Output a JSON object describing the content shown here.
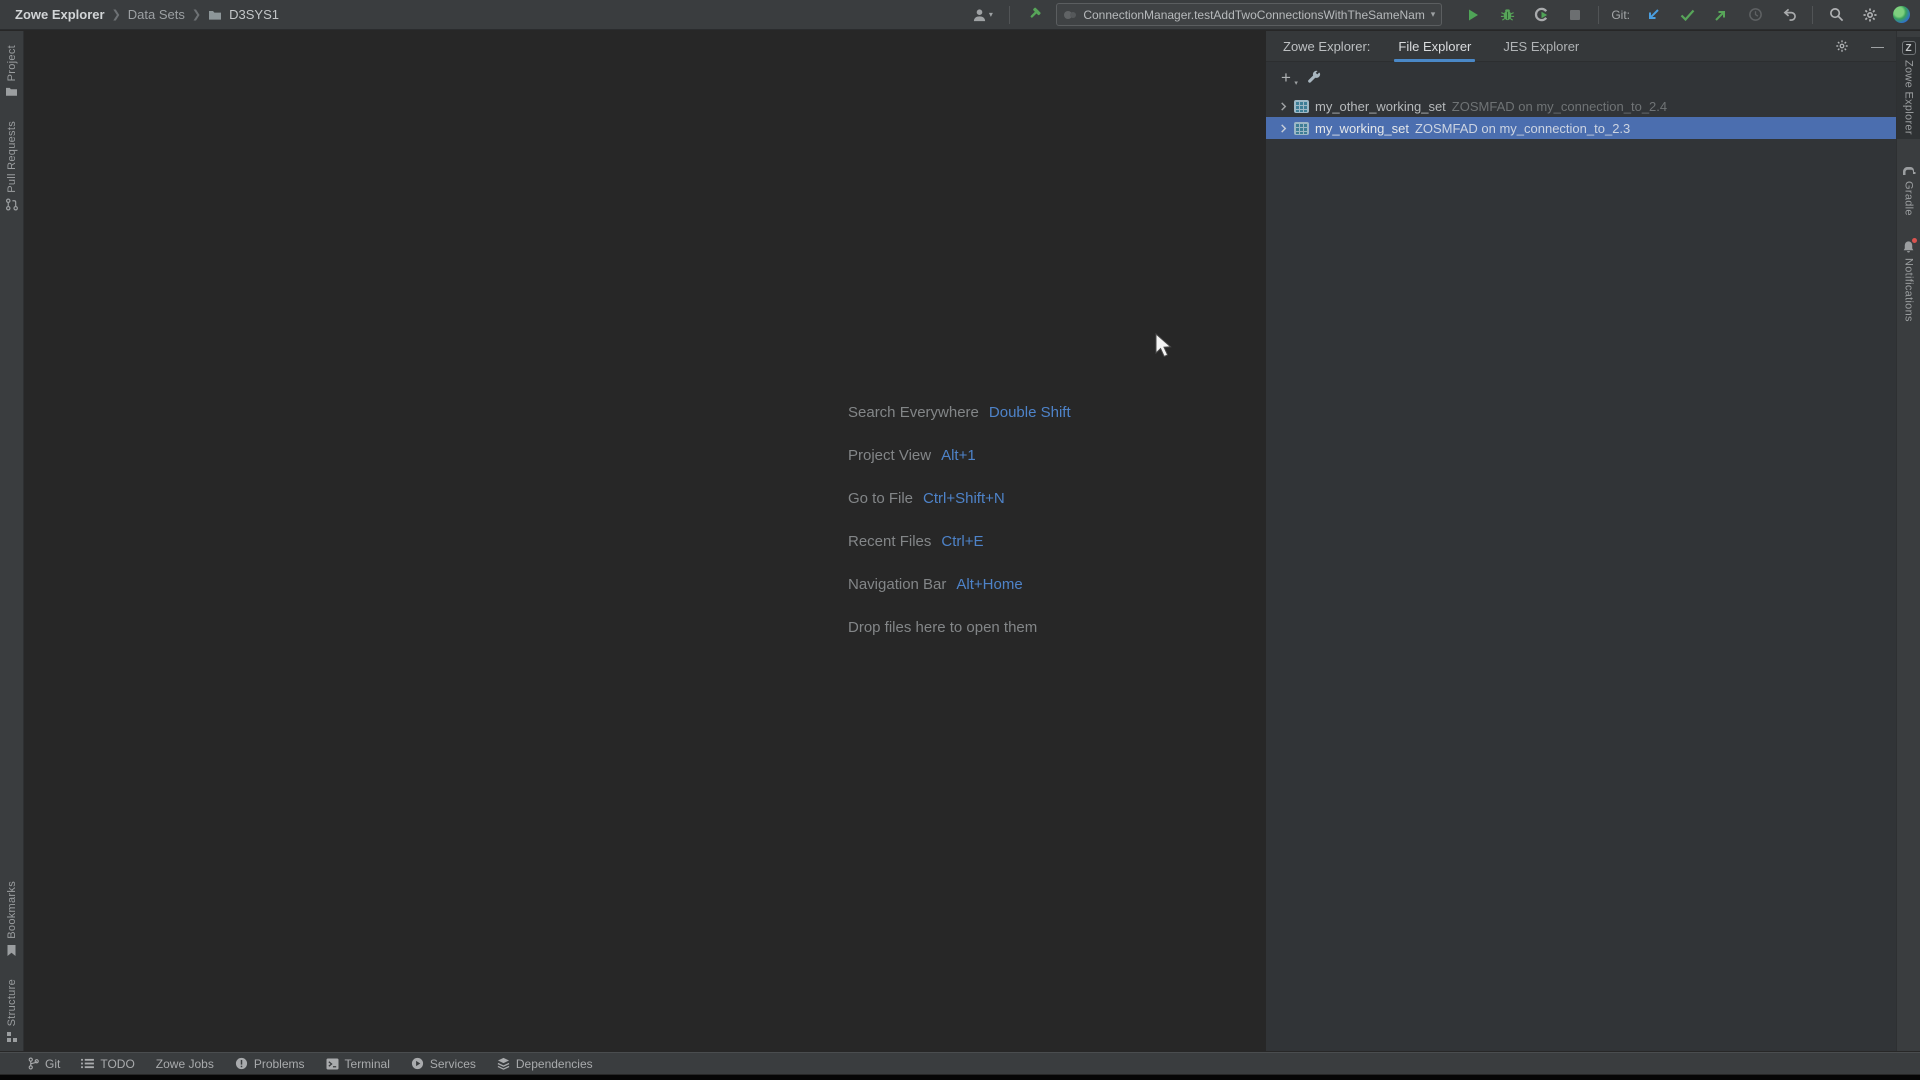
{
  "topbar": {
    "breadcrumb": {
      "root": "Zowe Explorer",
      "section": "Data Sets",
      "item": "D3SYS1"
    },
    "run_config": "ConnectionManager.testAddTwoConnectionsWithTheSameName",
    "git_label": "Git:",
    "combo_arrow": "▾",
    "user_caret": "▾"
  },
  "left_stripe": {
    "project": "Project",
    "pull_requests": "Pull Requests",
    "bookmarks": "Bookmarks",
    "structure": "Structure"
  },
  "right_stripe": {
    "zowe": "Zowe Explorer",
    "zowe_badge": "Z",
    "gradle": "Gradle",
    "notifications": "Notifications"
  },
  "editor": {
    "shortcuts": [
      {
        "label": "Search Everywhere",
        "keys": "Double Shift"
      },
      {
        "label": "Project View",
        "keys": "Alt+1"
      },
      {
        "label": "Go to File",
        "keys": "Ctrl+Shift+N"
      },
      {
        "label": "Recent Files",
        "keys": "Ctrl+E"
      },
      {
        "label": "Navigation Bar",
        "keys": "Alt+Home"
      }
    ],
    "drop_hint": "Drop files here to open them"
  },
  "panel": {
    "title": "Zowe Explorer:",
    "tabs": [
      {
        "label": "File Explorer",
        "active": true
      },
      {
        "label": "JES Explorer",
        "active": false
      }
    ],
    "add_label": "+",
    "add_caret": "▾",
    "minimize_glyph": "—",
    "tree": [
      {
        "name": "my_other_working_set",
        "detail": "ZOSMFAD on my_connection_to_2.4",
        "selected": false
      },
      {
        "name": "my_working_set",
        "detail": "ZOSMFAD on my_connection_to_2.3",
        "selected": true
      }
    ]
  },
  "statusbar": {
    "items": [
      {
        "label": "Git"
      },
      {
        "label": "TODO"
      },
      {
        "label": "Zowe Jobs"
      },
      {
        "label": "Problems"
      },
      {
        "label": "Terminal"
      },
      {
        "label": "Services"
      },
      {
        "label": "Dependencies"
      }
    ]
  },
  "colors": {
    "selection_blue": "#4b6eaf",
    "shortcut_key_blue": "#4e83c9",
    "tab_underline_blue": "#4a88c7",
    "run_green": "#57a559",
    "git_update_blue": "#4a9fe0",
    "notification_red": "#d9534f",
    "panel_bg": "#313437",
    "editor_bg": "#272727",
    "bar_bg": "#3a3d3f"
  }
}
